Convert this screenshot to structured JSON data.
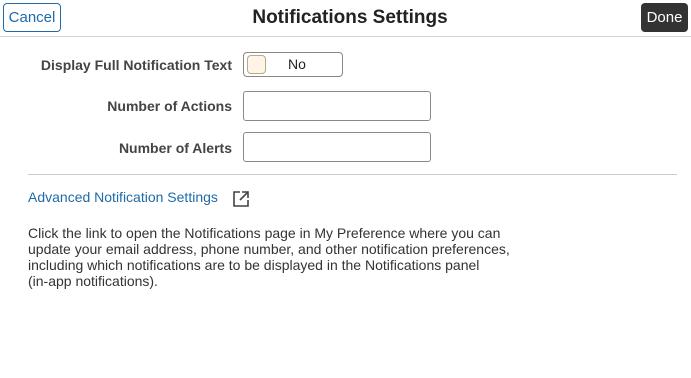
{
  "header": {
    "cancel_label": "Cancel",
    "title": "Notifications Settings",
    "done_label": "Done"
  },
  "form": {
    "display_full_text": {
      "label": "Display Full Notification Text",
      "value": "No"
    },
    "number_of_actions": {
      "label": "Number of Actions",
      "value": ""
    },
    "number_of_alerts": {
      "label": "Number of Alerts",
      "value": ""
    }
  },
  "advanced": {
    "link_label": "Advanced Notification Settings",
    "icon": "external-link-icon",
    "description_lines": [
      "Click the link to open the Notifications page in My Preference where you can",
      "update your email address, phone number, and other notification preferences,",
      "including which notifications are to be displayed in the Notifications panel",
      "(in-app notifications)."
    ]
  },
  "colors": {
    "link": "#1f6aa8",
    "done_bg": "#333333",
    "toggle_knob": "#fff5e6"
  }
}
